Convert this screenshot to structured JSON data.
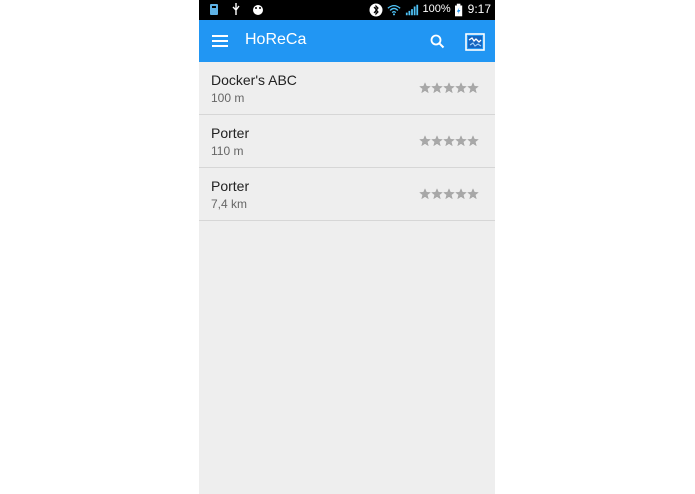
{
  "statusbar": {
    "battery_percent": "100%",
    "time": "9:17",
    "icons": [
      "storage-icon",
      "usb-icon",
      "android-debug-icon",
      "bluetooth-icon",
      "wifi-icon",
      "signal-icon",
      "battery-charging-icon"
    ]
  },
  "toolbar": {
    "title": "HoReCa",
    "menu_icon": "hamburger-menu-icon",
    "search_icon": "search-icon",
    "map_icon": "map-icon",
    "color": "#2196f3"
  },
  "places": [
    {
      "name": "Docker's ABC",
      "distance": "100 m",
      "rating": 0
    },
    {
      "name": "Porter",
      "distance": "110 m",
      "rating": 0
    },
    {
      "name": "Porter",
      "distance": "7,4 km",
      "rating": 0
    }
  ],
  "rating_max": 5
}
